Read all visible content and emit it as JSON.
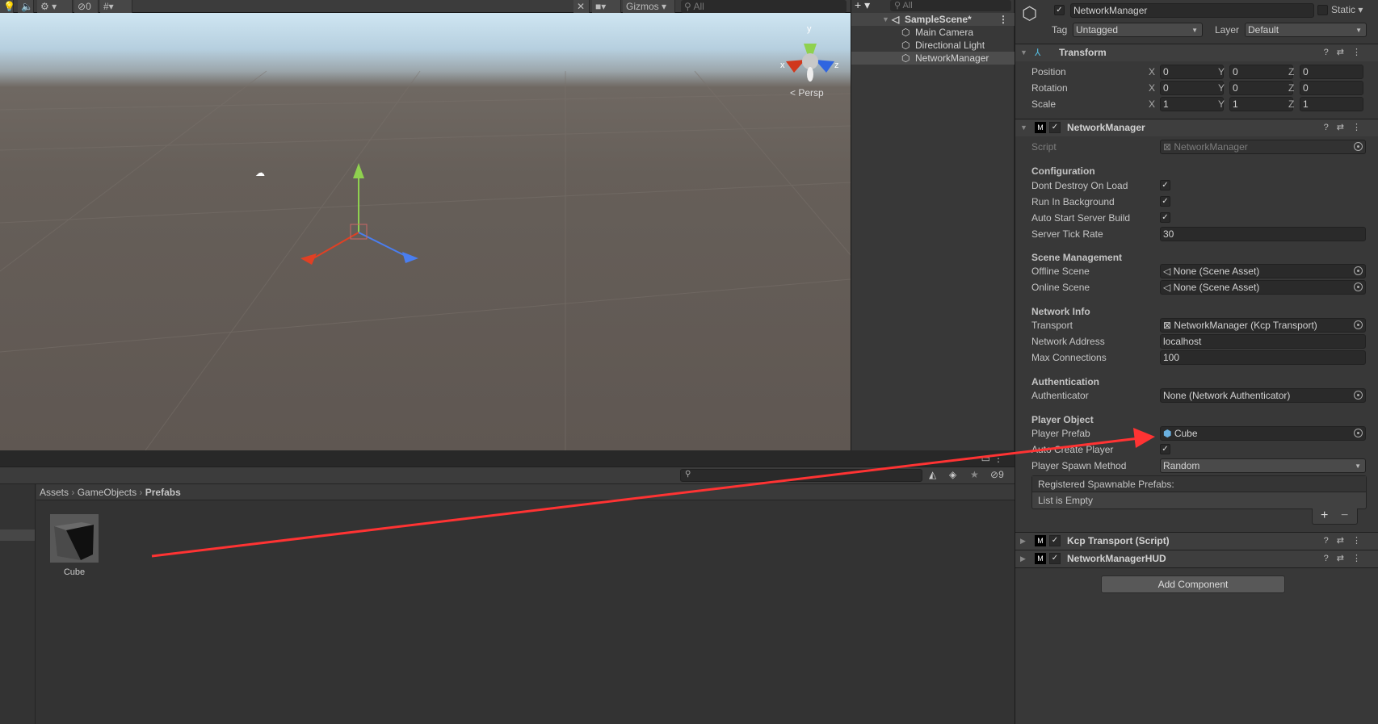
{
  "toolbar": {
    "hidden_count": "0",
    "gizmos_label": "Gizmos",
    "search_placeholder": "All"
  },
  "scene": {
    "projection_label": "Persp",
    "axis_x": "x",
    "axis_y": "y",
    "axis_z": "z"
  },
  "hierarchy": {
    "search_placeholder": "All",
    "scene_name": "SampleScene*",
    "items": [
      "Main Camera",
      "Directional Light",
      "NetworkManager"
    ],
    "selected": "NetworkManager"
  },
  "inspector": {
    "object_name": "NetworkManager",
    "active": true,
    "static_label": "Static",
    "tag_label": "Tag",
    "tag_value": "Untagged",
    "layer_label": "Layer",
    "layer_value": "Default",
    "transform": {
      "title": "Transform",
      "rows": [
        {
          "label": "Position",
          "x": "0",
          "y": "0",
          "z": "0"
        },
        {
          "label": "Rotation",
          "x": "0",
          "y": "0",
          "z": "0"
        },
        {
          "label": "Scale",
          "x": "1",
          "y": "1",
          "z": "1"
        }
      ],
      "axis": [
        "X",
        "Y",
        "Z"
      ]
    },
    "network_manager": {
      "title": "NetworkManager",
      "script_label": "Script",
      "script_value": "NetworkManager",
      "configuration": "Configuration",
      "dont_destroy": "Dont Destroy On Load",
      "run_bg": "Run In Background",
      "auto_start": "Auto Start Server Build",
      "tick_rate_label": "Server Tick Rate",
      "tick_rate": "30",
      "scene_mgmt": "Scene Management",
      "offline_label": "Offline Scene",
      "offline_value": "None (Scene Asset)",
      "online_label": "Online Scene",
      "online_value": "None (Scene Asset)",
      "network_info": "Network Info",
      "transport_label": "Transport",
      "transport_value": "NetworkManager (Kcp Transport)",
      "address_label": "Network Address",
      "address_value": "localhost",
      "max_conn_label": "Max Connections",
      "max_conn_value": "100",
      "auth": "Authentication",
      "authenticator_label": "Authenticator",
      "authenticator_value": "None (Network Authenticator)",
      "player_object": "Player Object",
      "player_prefab_label": "Player Prefab",
      "player_prefab_value": "Cube",
      "auto_create_label": "Auto Create Player",
      "spawn_method_label": "Player Spawn Method",
      "spawn_method_value": "Random",
      "registered_label": "Registered Spawnable Prefabs:",
      "list_empty": "List is Empty",
      "add": "+",
      "remove": "−"
    },
    "components": [
      "Kcp Transport (Script)",
      "NetworkManagerHUD"
    ],
    "add_component": "Add Component"
  },
  "project": {
    "breadcrumb": [
      "Assets",
      "GameObjects",
      "Prefabs"
    ],
    "hidden_count": "9",
    "assets": [
      {
        "name": "Cube"
      }
    ]
  },
  "colors": {
    "annotation_arrow": "#ff3333",
    "selection": "#4d4d4d"
  }
}
